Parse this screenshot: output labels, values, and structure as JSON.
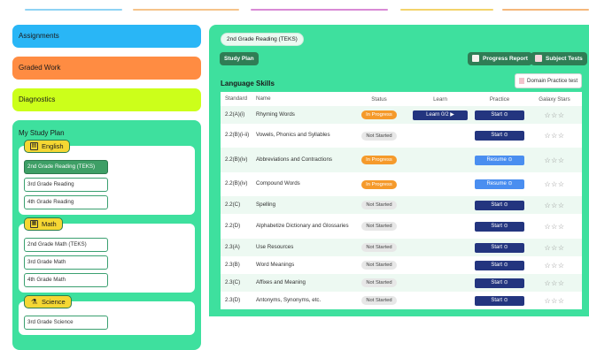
{
  "colors": {
    "assignments": "#29b6f6",
    "graded_work": "#ff8c42",
    "diagnostics": "#ccff1a",
    "panel": "#3ee09e",
    "accent_dark": "#2f7d55",
    "start": "#23357f",
    "resume": "#4a8ef0",
    "in_progress": "#f59a2b"
  },
  "sidebar": {
    "assignments": "Assignments",
    "graded_work": "Graded Work",
    "diagnostics": "Diagnostics",
    "study_plan_title": "My Study Plan",
    "subjects": [
      {
        "name": "English",
        "icon": "book-icon",
        "courses": [
          "2nd Grade Reading (TEKS)",
          "3rd Grade Reading",
          "4th Grade Reading"
        ]
      },
      {
        "name": "Math",
        "icon": "calculator-icon",
        "courses": [
          "2nd Grade Math (TEKS)",
          "3rd Grade Math",
          "4th Grade Math"
        ]
      },
      {
        "name": "Science",
        "icon": "flask-icon",
        "courses": [
          "3rd Grade Science"
        ]
      }
    ]
  },
  "main": {
    "breadcrumb": "2nd Grade Reading (TEKS)",
    "study_plan_btn": "Study Plan",
    "progress_report_btn": "Progress Report",
    "subject_tests_btn": "Subject Tests",
    "section_title": "Language Skills",
    "domain_practice_btn": "Domain Practice test",
    "columns": [
      "Standard",
      "Name",
      "Status",
      "Learn",
      "Practice",
      "Galaxy Stars"
    ],
    "stars": "☆☆☆",
    "rows": [
      {
        "standard": "2.2(A)(i)",
        "name": "Rhyming Words",
        "status": "In Progress",
        "learn": "Learn 0/2 ▶",
        "practice": "Start ⊙"
      },
      {
        "standard": "2.2(B)(i-ii)",
        "name": "Vowels, Phonics and Syllables",
        "status": "Not Started",
        "learn": "",
        "practice": "Start ⊙"
      },
      {
        "standard": "2.2(B)(iv)",
        "name": "Abbreviations and Contractions",
        "status": "In Progress",
        "learn": "",
        "practice": "Resume ⊙"
      },
      {
        "standard": "2.2(B)(iv)",
        "name": "Compound Words",
        "status": "In Progress",
        "learn": "",
        "practice": "Resume ⊙"
      },
      {
        "standard": "2.2(C)",
        "name": "Spelling",
        "status": "Not Started",
        "learn": "",
        "practice": "Start ⊙"
      },
      {
        "standard": "2.2(D)",
        "name": "Alphabetize Dictionary and Glossaries",
        "status": "Not Started",
        "learn": "",
        "practice": "Start ⊙"
      },
      {
        "standard": "2.3(A)",
        "name": "Use Resources",
        "status": "Not Started",
        "learn": "",
        "practice": "Start ⊙"
      },
      {
        "standard": "2.3(B)",
        "name": "Word Meanings",
        "status": "Not Started",
        "learn": "",
        "practice": "Start ⊙"
      },
      {
        "standard": "2.3(C)",
        "name": "Affixes and Meaning",
        "status": "Not Started",
        "learn": "",
        "practice": "Start ⊙"
      },
      {
        "standard": "2.3(D)",
        "name": "Antonyms, Synonyms, etc.",
        "status": "Not Started",
        "learn": "",
        "practice": "Start ⊙"
      }
    ]
  }
}
